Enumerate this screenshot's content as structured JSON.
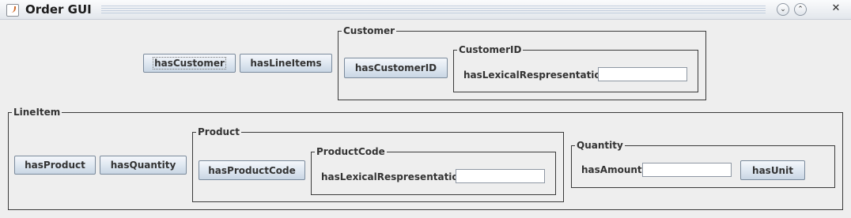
{
  "window": {
    "title": "Order GUI"
  },
  "main": {
    "has_customer": "hasCustomer",
    "has_line_items": "hasLineItems"
  },
  "customer": {
    "legend": "Customer",
    "has_customer_id": "hasCustomerID",
    "customer_id": {
      "legend": "CustomerID",
      "label": "hasLexicalRespresentation",
      "value": ""
    }
  },
  "line_item": {
    "legend": "LineItem",
    "has_product": "hasProduct",
    "has_quantity": "hasQuantity",
    "product": {
      "legend": "Product",
      "has_product_code": "hasProductCode",
      "product_code": {
        "legend": "ProductCode",
        "label": "hasLexicalRespresentation",
        "value": ""
      }
    },
    "quantity": {
      "legend": "Quantity",
      "has_amount_label": "hasAmount",
      "amount_value": "",
      "has_unit": "hasUnit"
    }
  }
}
